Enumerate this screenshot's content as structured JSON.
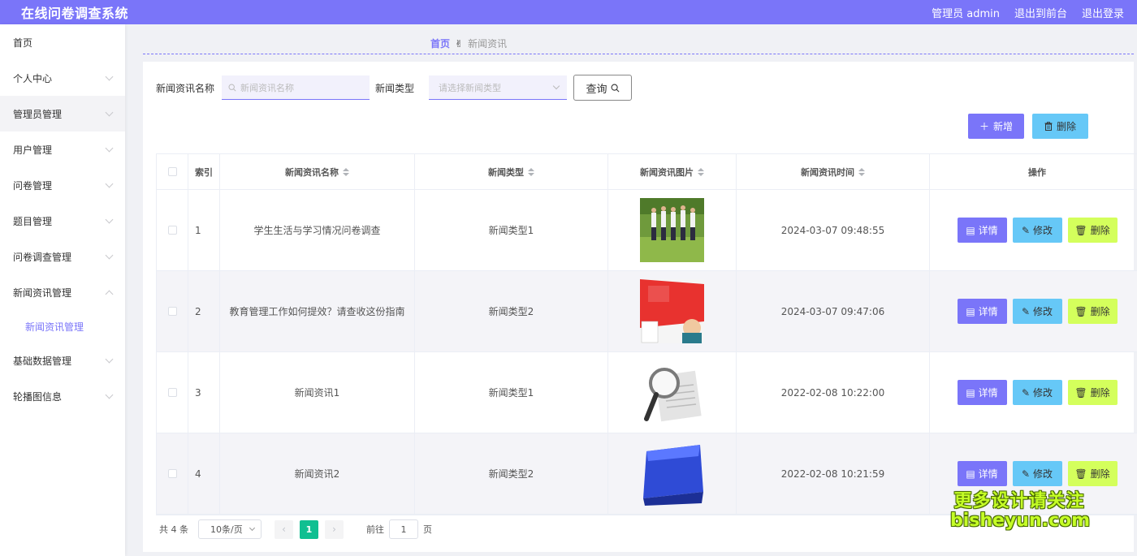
{
  "header": {
    "title": "在线问卷调查系统",
    "admin": "管理员 admin",
    "exit_front": "退出到前台",
    "logout": "退出登录"
  },
  "sidebar": {
    "items": [
      {
        "label": "首页"
      },
      {
        "label": "个人中心"
      },
      {
        "label": "管理员管理"
      },
      {
        "label": "用户管理"
      },
      {
        "label": "问卷管理"
      },
      {
        "label": "题目管理"
      },
      {
        "label": "问卷调查管理"
      },
      {
        "label": "新闻资讯管理"
      },
      {
        "label": "基础数据管理"
      },
      {
        "label": "轮播图信息"
      }
    ],
    "sub_item": "新闻资讯管理"
  },
  "breadcrumb": {
    "home": "首页",
    "current": "新闻资讯"
  },
  "search": {
    "name_label": "新闻资讯名称",
    "name_placeholder": "新闻资讯名称",
    "type_label": "新闻类型",
    "type_placeholder": "请选择新闻类型",
    "query_label": "查询"
  },
  "actions": {
    "add_label": "新增",
    "delete_label": "删除"
  },
  "table": {
    "headers": {
      "index": "索引",
      "name": "新闻资讯名称",
      "type": "新闻类型",
      "image": "新闻资讯图片",
      "time": "新闻资讯时间",
      "op": "操作"
    },
    "rows": [
      {
        "index": "1",
        "name": "学生生活与学习情况问卷调查",
        "type": "新闻类型1",
        "time": "2024-03-07 09:48:55",
        "image": "people-outdoor-photo"
      },
      {
        "index": "2",
        "name": "教育管理工作如何提效？请查收这份指南",
        "type": "新闻类型2",
        "time": "2024-03-07 09:47:06",
        "image": "questionnaire-poster"
      },
      {
        "index": "3",
        "name": "新闻资讯1",
        "type": "新闻类型1",
        "time": "2022-02-08 10:22:00",
        "image": "news-magnifier"
      },
      {
        "index": "4",
        "name": "新闻资讯2",
        "type": "新闻类型2",
        "time": "2022-02-08 10:21:59",
        "image": "news-key"
      }
    ],
    "op_labels": {
      "detail": "详情",
      "edit": "修改",
      "delete": "删除"
    }
  },
  "pagination": {
    "total": "共 4 条",
    "page_size": "10条/页",
    "current_page": "1",
    "goto_label": "前往",
    "goto_value": "1",
    "page_suffix": "页"
  },
  "watermark": {
    "line1": "更多设计请关注",
    "line2": "bisheyun.com"
  },
  "colors": {
    "accent": "#7a75f9",
    "info": "#66c8f7",
    "danger": "#d4ff5c",
    "page_active": "#10bf91"
  }
}
